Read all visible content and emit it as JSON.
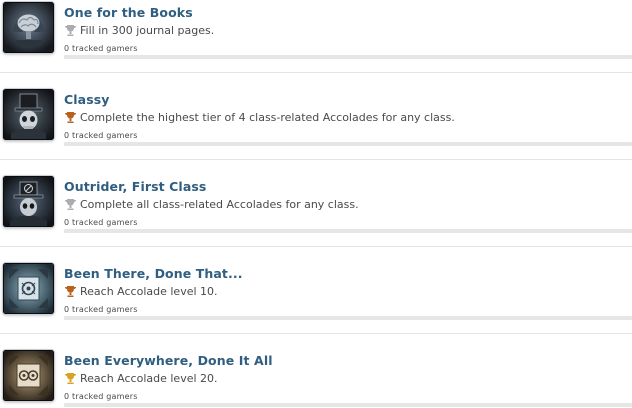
{
  "achievements": [
    {
      "title": "One for the Books",
      "description": "Fill in 300 journal pages.",
      "trophy": "silver-trophy-icon",
      "trophy_color": "#a9adb2",
      "tracked": "0 tracked gamers",
      "progress": 0,
      "icon": "brain-emblem-icon"
    },
    {
      "title": "Classy",
      "description": "Complete the highest tier of 4 class-related Accolades for any class.",
      "trophy": "bronze-trophy-icon",
      "trophy_color": "#b8621d",
      "tracked": "0 tracked gamers",
      "progress": 0,
      "icon": "tophat-skull-icon"
    },
    {
      "title": "Outrider, First Class",
      "description": "Complete all class-related Accolades for any class.",
      "trophy": "silver-trophy-icon",
      "trophy_color": "#a9adb2",
      "tracked": "0 tracked gamers",
      "progress": 0,
      "icon": "outrider-hat-icon"
    },
    {
      "title": "Been There, Done That...",
      "description": "Reach Accolade level 10.",
      "trophy": "bronze-trophy-icon",
      "trophy_color": "#b8621d",
      "tracked": "0 tracked gamers",
      "progress": 0,
      "icon": "accolade-level-10-icon"
    },
    {
      "title": "Been Everywhere, Done It All",
      "description": "Reach Accolade level 20.",
      "trophy": "gold-trophy-icon",
      "trophy_color": "#d9a21f",
      "tracked": "0 tracked gamers",
      "progress": 0,
      "icon": "accolade-level-20-icon"
    }
  ],
  "colors": {
    "title": "#2f5e80",
    "bar_track": "#e4e6e8",
    "divider": "#e2e4e6"
  }
}
